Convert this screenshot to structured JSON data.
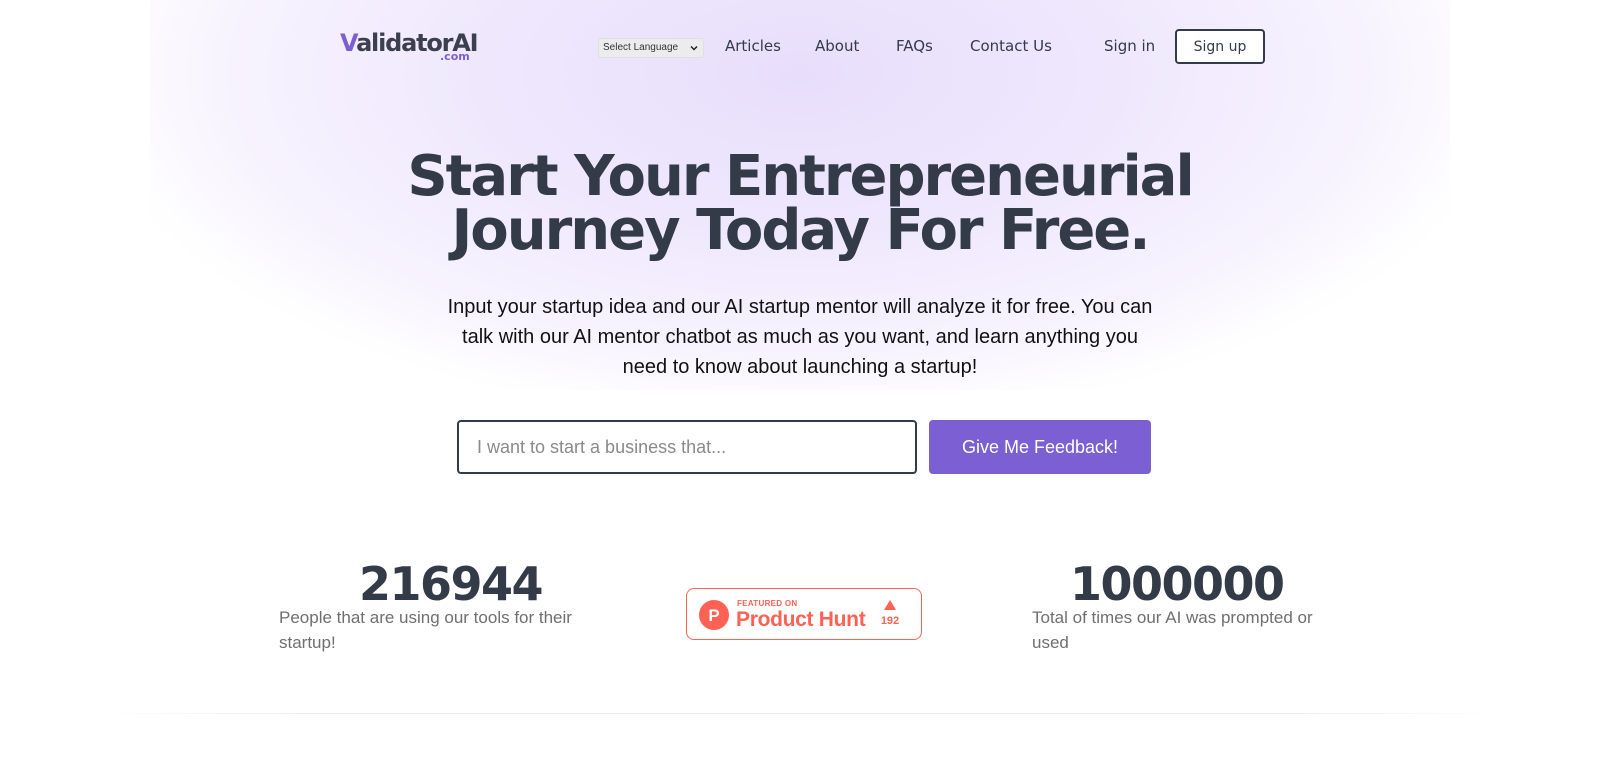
{
  "header": {
    "logo_main_prefix": "V",
    "logo_main_rest": "alidatorAI",
    "logo_sub": ".com",
    "language_select": "Select Language",
    "nav": {
      "articles": "Articles",
      "about": "About",
      "faqs": "FAQs",
      "contact": "Contact Us",
      "signin": "Sign in",
      "signup": "Sign up"
    }
  },
  "hero": {
    "title_line1": "Start Your Entrepreneurial",
    "title_line2": "Journey Today For Free.",
    "subtitle": "Input your startup idea and our AI startup mentor will analyze it for free. You can talk with our AI mentor chatbot as much as you want, and learn anything you need to know about launching a startup!",
    "input_placeholder": "I want to start a business that...",
    "input_value": "",
    "cta_label": "Give Me Feedback!"
  },
  "stats": {
    "users_count": "216944",
    "users_desc": "People that are using our tools for their startup!",
    "prompts_count": "1000000",
    "prompts_desc": "Total of times our AI was prompted or used"
  },
  "product_hunt": {
    "featured": "FEATURED ON",
    "name": "Product Hunt",
    "upvotes": "192",
    "logo_letter": "P"
  },
  "colors": {
    "brand": "#7b5fd3",
    "text_dark": "#333a48",
    "product_hunt": "#ff6154"
  }
}
